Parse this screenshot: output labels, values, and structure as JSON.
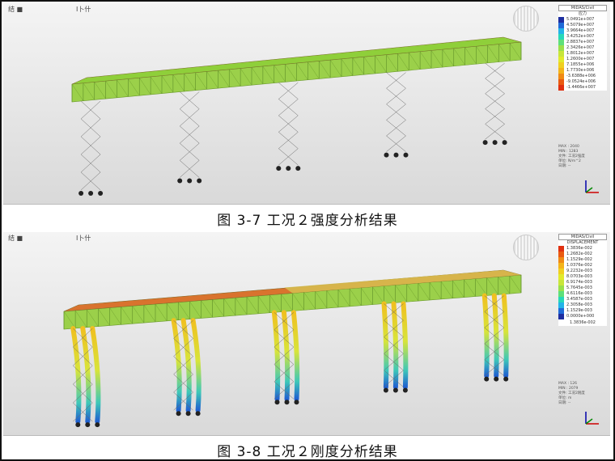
{
  "captions": {
    "fig1": "图 3-7 工况２强度分析结果",
    "fig2": "图 3-8 工况２刚度分析结果"
  },
  "panel1": {
    "toolbar_left": "结 ■",
    "toolbar_mid": "Ⅰ卜什",
    "legend_head": "MIDAS/Civil",
    "legend_title": "应力",
    "legend_values": [
      "5.0491e+007",
      "4.5079e+007",
      "3.9664e+007",
      "3.4252e+007",
      "2.8837e+007",
      "2.3426e+007",
      "1.8012e+007",
      "1.2600e+007",
      "7.1855e+006",
      "1.7730e+006",
      "-3.6388e+006",
      "-9.0524e+006",
      "-1.4466e+007"
    ],
    "info_lines": [
      "MAX : 2040",
      "MIN : 1283",
      "文件: 工况2强度",
      "单位: N/m^2",
      "日期: --"
    ],
    "scheme": "stress"
  },
  "panel2": {
    "toolbar_left": "结 ■",
    "toolbar_mid": "Ⅰ卜什",
    "legend_head": "MIDAS/Civil",
    "legend_title": "DISPLACEMENT",
    "legend_values": [
      "1.3836e-002",
      "1.2682e-002",
      "1.1529e-002",
      "1.0376e-002",
      "9.2232e-003",
      "8.0703e-003",
      "6.9174e-003",
      "5.7645e-003",
      "4.6116e-003",
      "3.4587e-003",
      "2.3058e-003",
      "1.1529e-003",
      "0.0000e+000"
    ],
    "max_value": "1.3836e-002",
    "info_lines": [
      "MAX : 126",
      "MIN : 2079",
      "文件: 工况2刚度",
      "单位: m",
      "日期: --"
    ],
    "scheme": "displacement"
  },
  "colors": {
    "stress_scale": [
      "#1e2ea0",
      "#1f6ad8",
      "#23b4e8",
      "#27d8b8",
      "#5ee07a",
      "#9ae04a",
      "#c8e63a",
      "#e2ea2c",
      "#f0d020",
      "#f4b41a",
      "#f08a14",
      "#ea5a10",
      "#e03010"
    ],
    "disp_scale": [
      "#e03010",
      "#ea5a10",
      "#f08a14",
      "#f4b41a",
      "#f0d020",
      "#e2ea2c",
      "#c8e63a",
      "#9ae04a",
      "#5ee07a",
      "#27d8b8",
      "#23b4e8",
      "#1f6ad8",
      "#1e2ea0"
    ],
    "deck_green": "#8fcf3a",
    "deck_orange": "#d9732e"
  }
}
